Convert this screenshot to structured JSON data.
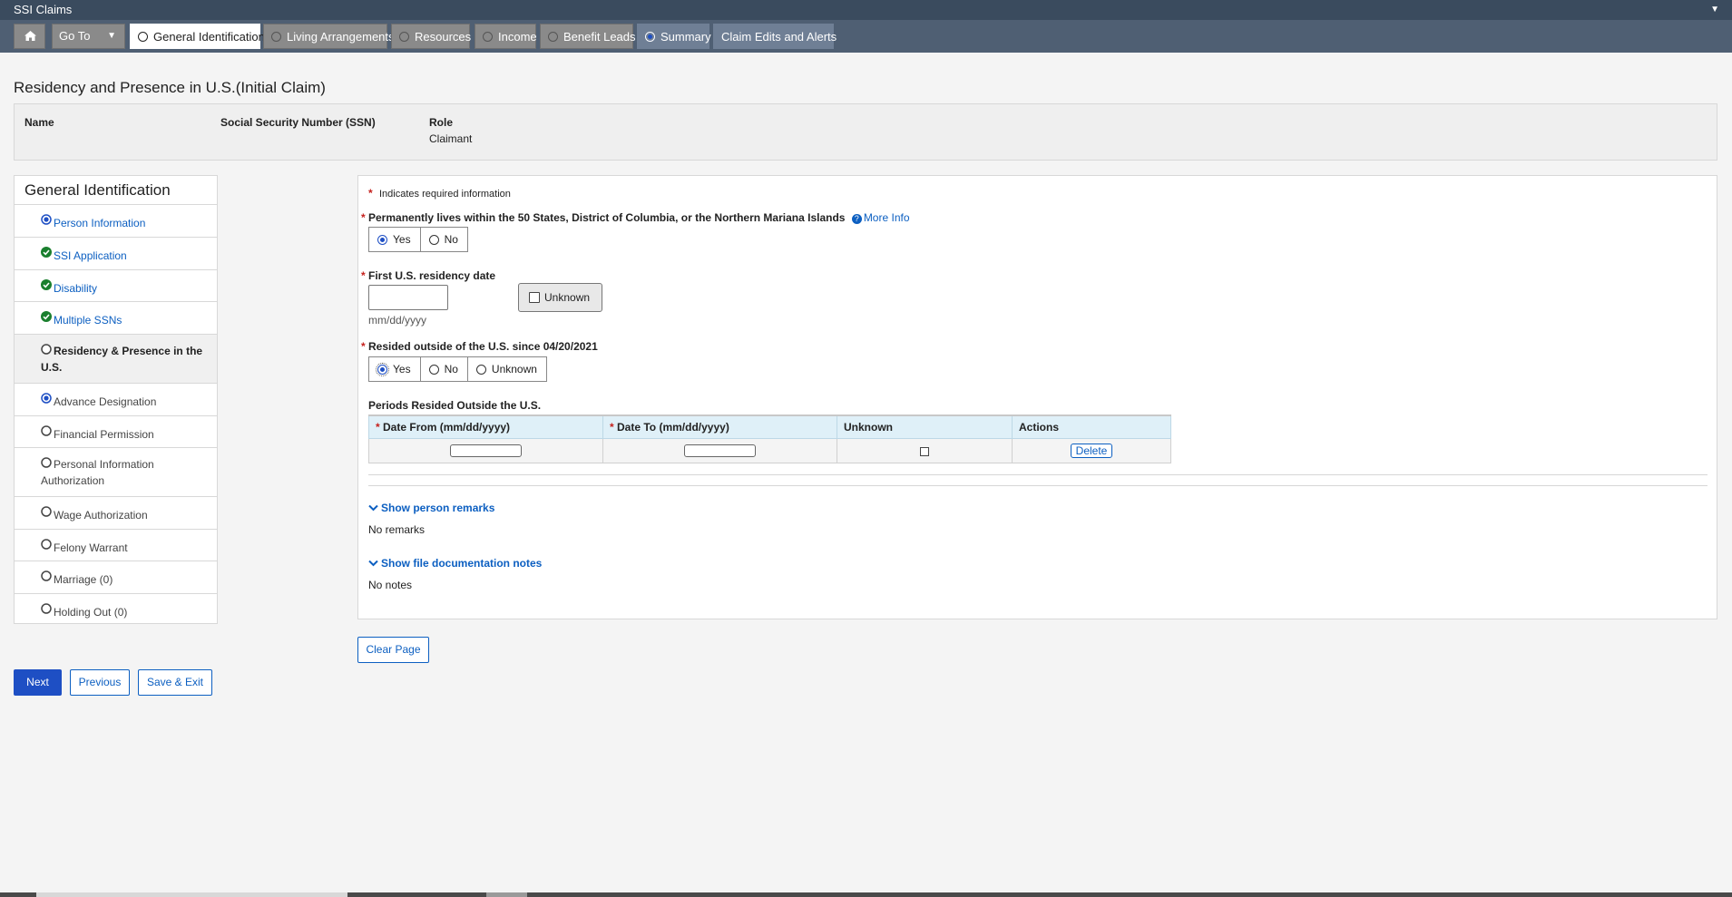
{
  "app": {
    "title": "SSI Claims"
  },
  "nav": {
    "goto_label": "Go To",
    "tabs": [
      {
        "label": "General Identification"
      },
      {
        "label": "Living Arrangements"
      },
      {
        "label": "Resources"
      },
      {
        "label": "Income"
      },
      {
        "label": "Benefit Leads"
      },
      {
        "label": "Summary"
      },
      {
        "label": "Claim Edits and Alerts"
      }
    ]
  },
  "page": {
    "heading": "Residency and Presence in U.S.(Initial Claim)"
  },
  "person": {
    "name_label": "Name",
    "ssn_label": "Social Security Number (SSN)",
    "role_label": "Role",
    "role_value": "Claimant"
  },
  "sidebar": {
    "title": "General Identification",
    "items": [
      {
        "label": "Person Information",
        "status": "selected-radio"
      },
      {
        "label": "SSI Application",
        "status": "complete-check"
      },
      {
        "label": "Disability",
        "status": "complete-check"
      },
      {
        "label": "Multiple SSNs",
        "status": "complete-check"
      },
      {
        "label": "Residency & Presence in the U.S.",
        "status": "current"
      },
      {
        "label": "Advance Designation",
        "status": "selected-radio"
      },
      {
        "label": "Financial Permission",
        "status": "empty-radio"
      },
      {
        "label": "Personal Information Authorization",
        "status": "empty-radio"
      },
      {
        "label": "Wage Authorization",
        "status": "empty-radio"
      },
      {
        "label": "Felony Warrant",
        "status": "empty-radio"
      },
      {
        "label": "Marriage (0)",
        "status": "empty-radio"
      },
      {
        "label": "Holding Out (0)",
        "status": "empty-radio"
      }
    ]
  },
  "form": {
    "required_note": "Indicates required information",
    "q1": {
      "label": "Permanently lives within the 50 States, District of Columbia, or the Northern Mariana Islands",
      "more_info": "More Info",
      "options": [
        "Yes",
        "No"
      ],
      "selected": "Yes"
    },
    "q2": {
      "label": "First U.S. residency date",
      "value": "",
      "hint": "mm/dd/yyyy",
      "unknown_label": "Unknown"
    },
    "q3": {
      "label": "Resided outside of the U.S. since 04/20/2021",
      "options": [
        "Yes",
        "No",
        "Unknown"
      ],
      "selected": "Yes"
    },
    "periods": {
      "title": "Periods Resided Outside the U.S.",
      "columns": [
        "Date From (mm/dd/yyyy)",
        "Date To (mm/dd/yyyy)",
        "Unknown",
        "Actions"
      ],
      "rows": [
        {
          "date_from": "",
          "date_to": "",
          "unknown": false,
          "action": "Delete"
        }
      ]
    },
    "remarks": {
      "toggle": "Show person remarks",
      "text": "No remarks"
    },
    "notes": {
      "toggle": "Show file documentation notes",
      "text": "No notes"
    }
  },
  "buttons": {
    "clear_page": "Clear Page",
    "next": "Next",
    "previous": "Previous",
    "save_exit": "Save & Exit"
  },
  "colors": {
    "titlebar": "#3a4b5e",
    "navbar": "#4f5f73",
    "accent": "#1e4fc4",
    "link": "#0c5fc1",
    "required": "#c5211d",
    "complete": "#1a7f2e"
  }
}
